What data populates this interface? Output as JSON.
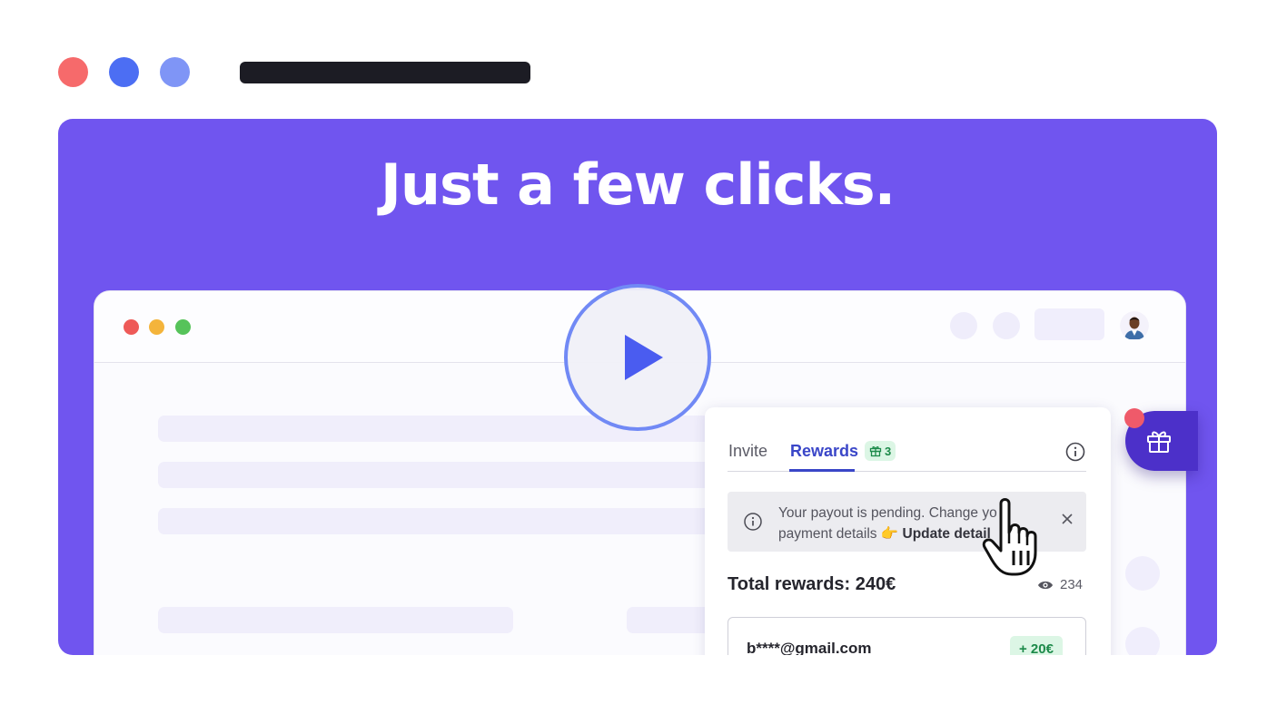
{
  "window_controls": {
    "colors": [
      "#f66a6b",
      "#4c6ef3",
      "#7f95f6"
    ]
  },
  "hero": {
    "headline": "Just a few clicks."
  },
  "widget": {
    "tabs": [
      {
        "label": "Invite"
      },
      {
        "label": "Rewards",
        "badge_count": "3"
      }
    ],
    "alert": {
      "line1": "Your payout is pending. Change yo",
      "line2_prefix": "payment details",
      "emoji": "👉",
      "link": "Update detail"
    },
    "total_rewards": "Total rewards: 240€",
    "views_count": "234",
    "rewards": [
      {
        "email": "b****@gmail.com",
        "amount": "+ 20€"
      }
    ]
  },
  "colors": {
    "stage": "#7055ef",
    "accent": "#3a46c8",
    "success": "#1d8a4a",
    "play_button": "#4a5cf0"
  },
  "icons": [
    "gift-icon",
    "info-icon",
    "close-icon",
    "eye-icon",
    "play-icon",
    "pointer-hand-icon",
    "avatar"
  ]
}
